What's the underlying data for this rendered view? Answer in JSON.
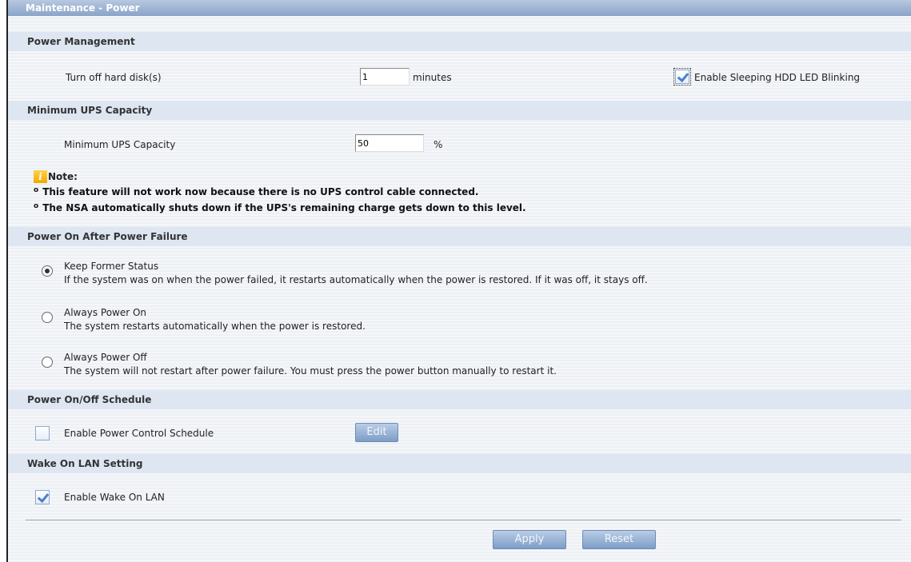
{
  "header": {
    "title": "Maintenance - Power"
  },
  "power_management": {
    "section_title": "Power Management",
    "turn_off_label": "Turn off hard disk(s)",
    "turn_off_value": "1",
    "minutes_unit": "minutes",
    "sleeping_led_label": "Enable Sleeping HDD LED Blinking",
    "sleeping_led_checked": true
  },
  "ups": {
    "section_title": "Minimum UPS Capacity",
    "capacity_label": "Minimum UPS Capacity",
    "capacity_value": "50",
    "percent_unit": "%"
  },
  "note": {
    "title": "Note:",
    "bullet_1": "This feature will not work now because there is no UPS control cable connected.",
    "bullet_2": "The NSA automatically shuts down if the UPS's remaining charge gets down to this level."
  },
  "power_failure": {
    "section_title": "Power On After Power Failure",
    "options": [
      {
        "label": "Keep Former Status",
        "description": "If the system was on when the power failed, it restarts automatically when the power is restored. If it was off, it stays off.",
        "selected": true
      },
      {
        "label": "Always Power On",
        "description": "The system restarts automatically when the power is restored.",
        "selected": false
      },
      {
        "label": "Always Power Off",
        "description": "The system will not restart after power failure. You must press the power button manually to restart it.",
        "selected": false
      }
    ]
  },
  "schedule": {
    "section_title": "Power On/Off Schedule",
    "enable_label": "Enable Power Control Schedule",
    "enable_checked": false,
    "edit_button": "Edit"
  },
  "wol": {
    "section_title": "Wake On LAN Setting",
    "enable_label": "Enable Wake On LAN",
    "enable_checked": true
  },
  "actions": {
    "apply": "Apply",
    "reset": "Reset"
  }
}
